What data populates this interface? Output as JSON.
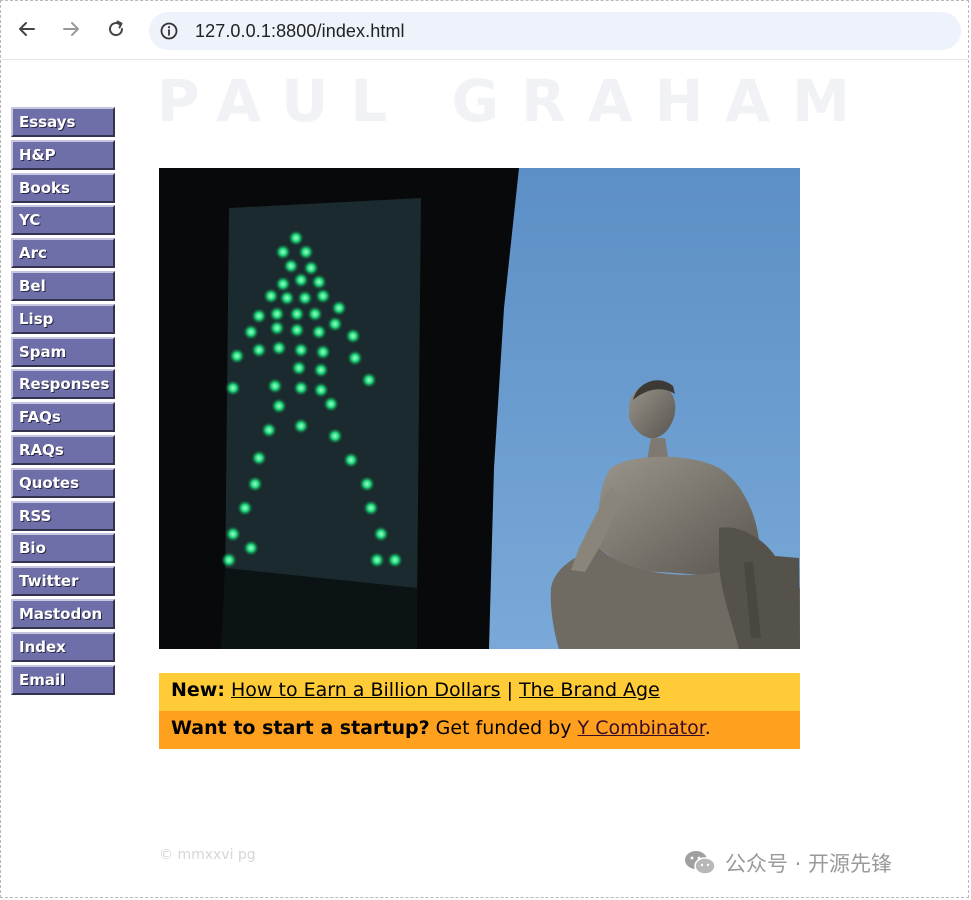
{
  "browser": {
    "url": "127.0.0.1:8800/index.html",
    "icons": {
      "back": "back-arrow-icon",
      "forward": "forward-arrow-icon",
      "reload": "reload-icon",
      "site_info": "info-icon"
    }
  },
  "page": {
    "site_name": "PAUL GRAHAM",
    "menu": [
      {
        "label": "Essays"
      },
      {
        "label": "H&P"
      },
      {
        "label": "Books"
      },
      {
        "label": "YC"
      },
      {
        "label": "Arc"
      },
      {
        "label": "Bel"
      },
      {
        "label": "Lisp"
      },
      {
        "label": "Spam"
      },
      {
        "label": "Responses"
      },
      {
        "label": "FAQs"
      },
      {
        "label": "RAQs"
      },
      {
        "label": "Quotes"
      },
      {
        "label": "RSS"
      },
      {
        "label": "Bio"
      },
      {
        "label": "Twitter"
      },
      {
        "label": "Mastodon"
      },
      {
        "label": "Index"
      },
      {
        "label": "Email"
      }
    ],
    "news": {
      "new_label": "New:",
      "link1": "How to Earn a Billion Dollars",
      "separator": "|",
      "link2": "The Brand Age",
      "startup_label": "Want to start a startup?",
      "startup_text": "Get funded by",
      "startup_link": "Y Combinator",
      "startup_end": "."
    },
    "copyright": "© mmxxvi pg"
  },
  "watermark": {
    "text": "公众号 · 开源先锋",
    "icon": "wechat-icon"
  },
  "colors": {
    "menu_bg": "#6e6ea8",
    "news_row1": "#ffcb36",
    "news_row2": "#ffa11f",
    "address_bar": "#eef2fb"
  }
}
